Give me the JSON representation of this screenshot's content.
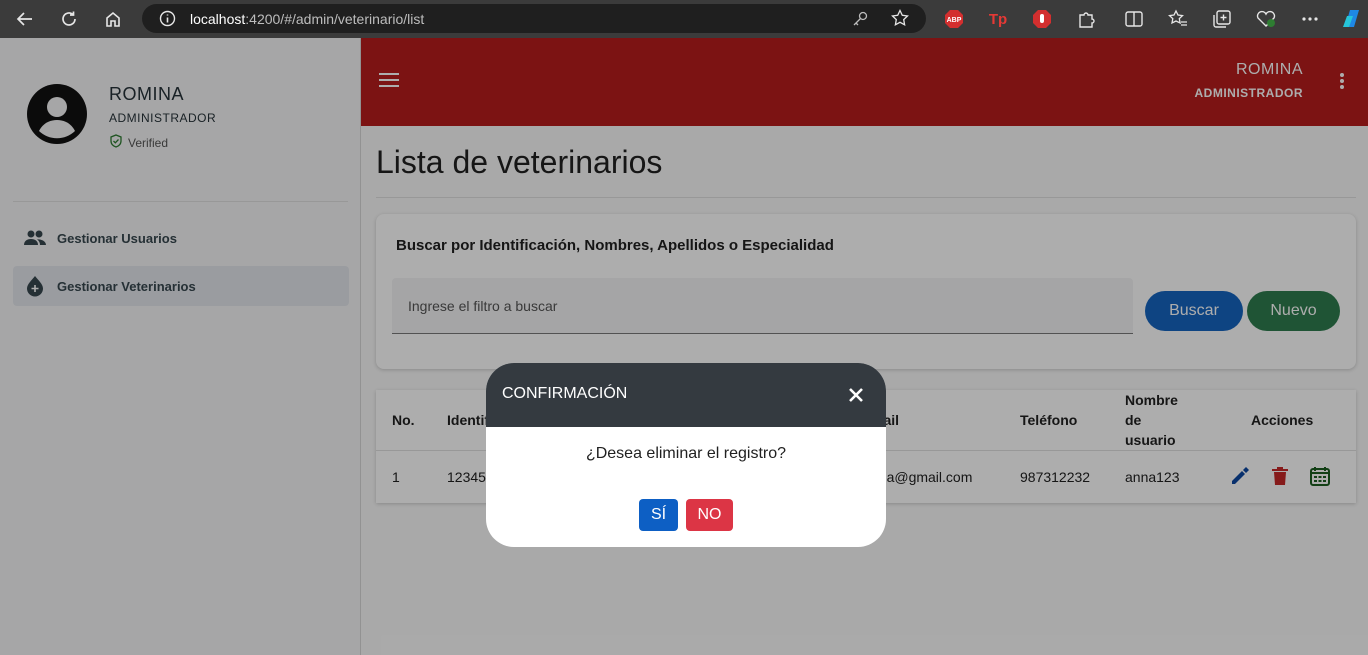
{
  "browser": {
    "url_host": "localhost",
    "url_rest": ":4200/#/admin/veterinario/list"
  },
  "sidebar": {
    "user_name": "ROMINA",
    "user_role": "ADMINISTRADOR",
    "verified": "Verified",
    "items": [
      {
        "label": "Gestionar Usuarios",
        "icon": "people-icon"
      },
      {
        "label": "Gestionar Veterinarios",
        "icon": "medical-drop-icon"
      }
    ]
  },
  "header": {
    "user_name": "ROMINA",
    "user_role": "ADMINISTRADOR"
  },
  "main": {
    "title": "Lista de veterinarios",
    "search": {
      "label": "Buscar por Identificación, Nombres, Apellidos o Especialidad",
      "placeholder": "Ingrese el filtro a buscar",
      "buscar_label": "Buscar",
      "nuevo_label": "Nuevo"
    },
    "table": {
      "headers": {
        "no": "No.",
        "identificacion": "Identif",
        "email": "mail",
        "telefono": "Teléfono",
        "usuario_1": "Nombre",
        "usuario_2": "de",
        "usuario_3": "usuario",
        "acciones": "Acciones"
      },
      "rows": [
        {
          "no": "1",
          "identificacion": "12345",
          "email": "nna@gmail.com",
          "telefono": "987312232",
          "usuario": "anna123"
        }
      ]
    }
  },
  "dialog": {
    "title": "CONFIRMACIÓN",
    "message": "¿Desea eliminar el registro?",
    "yes_label": "SÍ",
    "no_label": "NO"
  },
  "colors": {
    "header": "#b71c1c",
    "buscar": "#1565c0",
    "nuevo": "#2e7d4f",
    "dialog_head": "#343a40",
    "yes": "#0d5fc4",
    "no": "#dc3545"
  }
}
